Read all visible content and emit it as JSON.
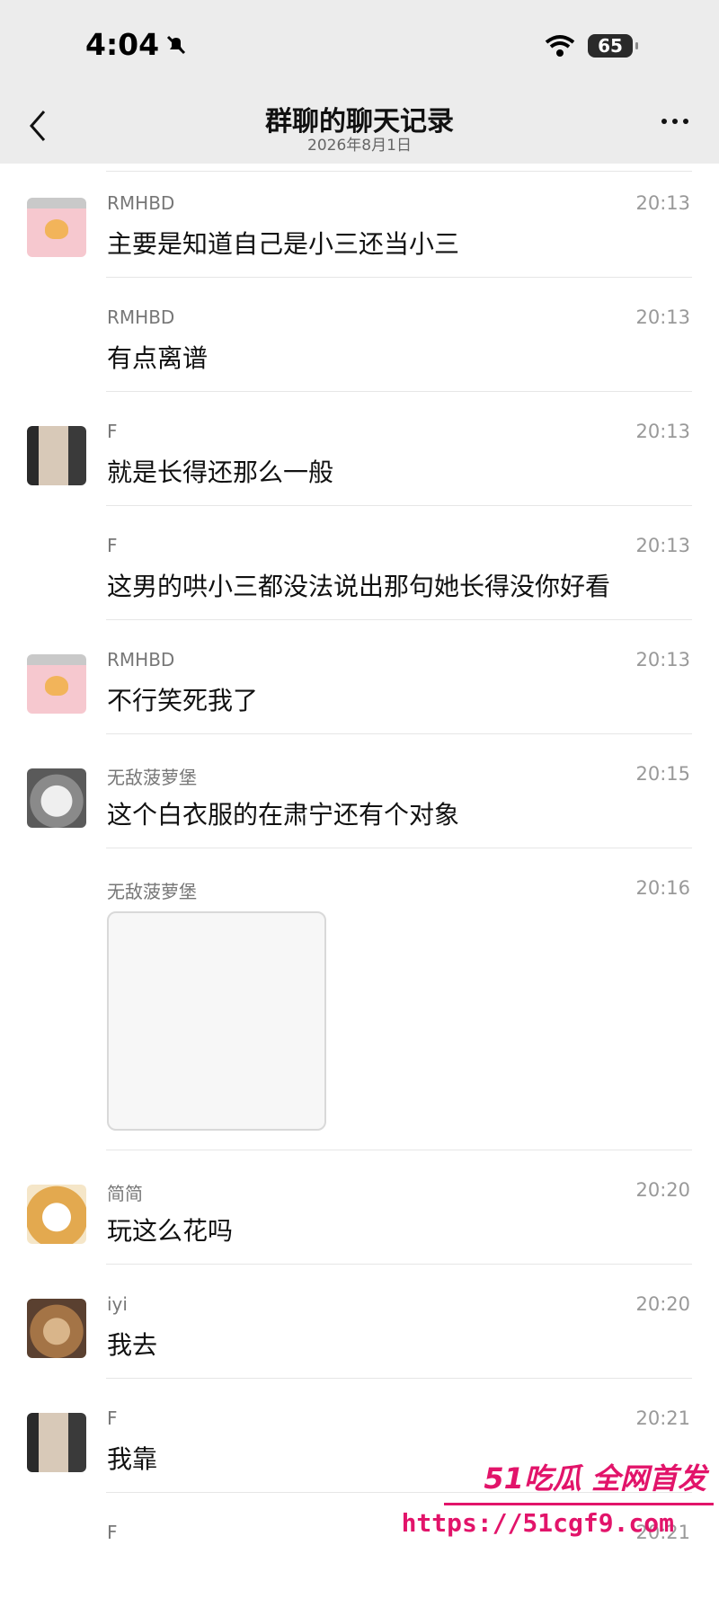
{
  "status_bar": {
    "time": "4:04",
    "battery": "65"
  },
  "header": {
    "title": "群聊的聊天记录",
    "subtitle": "2026年8月1日"
  },
  "messages": [
    {
      "sender": "RMHBD",
      "time": "20:13",
      "text": "主要是知道自己是小三还当小三",
      "avatar": "rmhbd"
    },
    {
      "sender": "RMHBD",
      "time": "20:13",
      "text": "有点离谱",
      "avatar": ""
    },
    {
      "sender": "F",
      "time": "20:13",
      "text": "就是长得还那么一般",
      "avatar": "f"
    },
    {
      "sender": "F",
      "time": "20:13",
      "text": "这男的哄小三都没法说出那句她长得没你好看",
      "avatar": ""
    },
    {
      "sender": "RMHBD",
      "time": "20:13",
      "text": "不行笑死我了",
      "avatar": "rmhbd"
    },
    {
      "sender": "无敌菠萝堡",
      "time": "20:15",
      "text": "这个白衣服的在肃宁还有个对象",
      "avatar": "cat"
    },
    {
      "sender": "无敌菠萝堡",
      "time": "20:16",
      "text": "",
      "avatar": ""
    },
    {
      "sender": "简简",
      "time": "20:20",
      "text": "玩这么花吗",
      "avatar": "bread"
    },
    {
      "sender": "iyi",
      "time": "20:20",
      "text": "我去",
      "avatar": "iyi"
    },
    {
      "sender": "F",
      "time": "20:21",
      "text": "我靠",
      "avatar": "f"
    },
    {
      "sender": "F",
      "time": "20:21",
      "text": "",
      "avatar": ""
    }
  ],
  "watermark": {
    "brand": "51吃瓜 全网首发",
    "url": "https://51cgf9.com"
  }
}
